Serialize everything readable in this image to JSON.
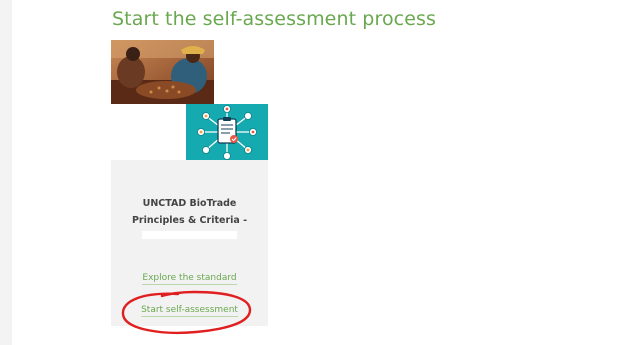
{
  "page": {
    "title": "Start the self-assessment process"
  },
  "images": {
    "photo_icon": "farmers-sorting-seeds-photo",
    "diagram_icon": "clipboard-checklist-icon",
    "colors": {
      "title_green": "#6aa84f",
      "diagram_teal": "#14aab0",
      "annotation_red": "#e02020"
    }
  },
  "card": {
    "title_line1": "UNCTAD BioTrade",
    "title_line2": "Principles & Criteria -",
    "explore_label": "Explore the standard",
    "start_label": "Start self-assessment"
  }
}
